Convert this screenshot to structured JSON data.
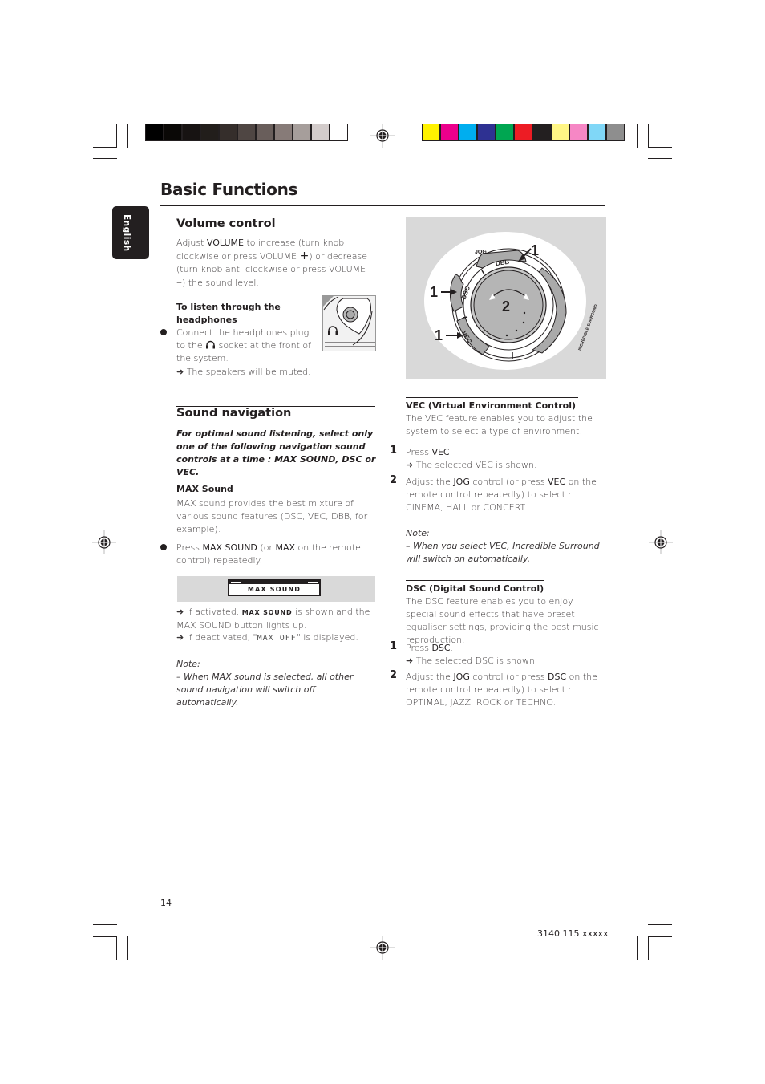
{
  "print_marks": {
    "grayscale_swatches": [
      "#000000",
      "#0a0806",
      "#171312",
      "#221e1b",
      "#352e2b",
      "#4f4643",
      "#695e5b",
      "#877b78",
      "#a69e9b",
      "#d3cccb",
      "#ffffff"
    ],
    "color_swatches": [
      "#fff200",
      "#ec008c",
      "#00aeef",
      "#2e3192",
      "#00a651",
      "#ed1c24",
      "#231f20",
      "#fff685",
      "#f687c5",
      "#80d7f7",
      "#8e8e8e"
    ]
  },
  "page": {
    "title": "Basic Functions",
    "language_tab": "English",
    "page_number": "14",
    "doc_code": "3140 115 xxxxx"
  },
  "volume_control": {
    "heading": "Volume control",
    "text_1": "Adjust ",
    "bold_volume": "VOLUME",
    "text_2": " to increase (turn knob clockwise or press VOLUME ",
    "plus": "+",
    "text_3": ") or decrease (turn knob anti-clockwise or press VOLUME ",
    "minus": "–",
    "text_4": ") the sound level.",
    "headphones": {
      "heading": "To listen through the headphones",
      "step_1a": "Connect the headphones plug to the ",
      "step_1b": " socket at the front of the system.",
      "result": "➜ The speakers will be muted.",
      "icon": "headphones-icon"
    }
  },
  "sound_navigation": {
    "heading": "Sound navigation",
    "intro": "For optimal sound listening, select only one of the following navigation sound controls at a time : MAX SOUND, DSC or VEC.",
    "max_sound": {
      "heading": "MAX Sound",
      "description": "MAX sound provides the best mixture of various sound features (DSC, VEC, DBB, for example).",
      "step_prefix": "Press ",
      "step_bold_1": "MAX SOUND",
      "step_mid": " (or ",
      "step_bold_2": "MAX",
      "step_suffix": " on the remote control) repeatedly.",
      "display_label": "MAX SOUND",
      "result_1a": "➜ If activated, ",
      "result_1_caps": "MAX SOUND",
      "result_1b": " is shown and the MAX SOUND button lights up.",
      "result_2a": "➜ If deactivated, \"",
      "result_2_lcd": "MAX OFF",
      "result_2b": "\" is displayed.",
      "note_label": "Note:",
      "note_text": "–  When MAX sound is selected, all other sound navigation will switch off automatically."
    }
  },
  "diagram": {
    "labels": {
      "jog": "JOG",
      "dbb": "DBB",
      "dsc": "DSC",
      "vec": "VEC",
      "surround": "INCREDIBLE SURROUND",
      "callout_1": "1",
      "callout_2": "2"
    }
  },
  "vec": {
    "heading": "VEC (Virtual Environment Control)",
    "description": "The VEC feature enables you to adjust the system to select a type of environment.",
    "steps": [
      {
        "num": "1",
        "prefix": "Press ",
        "bold": "VEC",
        "suffix": ".",
        "result": "➜ The selected VEC is shown."
      },
      {
        "num": "2",
        "prefix": "Adjust the ",
        "bold": "JOG",
        "mid": " control (or press ",
        "bold2": "VEC",
        "suffix": " on the remote control repeatedly) to select : CINEMA, HALL or CONCERT."
      }
    ],
    "note_label": "Note:",
    "note_text": "–  When you select VEC, Incredible Surround will switch on automatically."
  },
  "dsc": {
    "heading": "DSC (Digital Sound Control)",
    "description": "The DSC feature enables you to enjoy special sound effects that have preset equaliser settings, providing the best music reproduction.",
    "steps": [
      {
        "num": "1",
        "prefix": "Press ",
        "bold": "DSC",
        "suffix": ".",
        "result": "➜ The selected DSC is shown."
      },
      {
        "num": "2",
        "prefix": "Adjust the ",
        "bold": "JOG",
        "mid": " control (or press ",
        "bold2": "DSC",
        "suffix": " on the remote control repeatedly) to select : OPTIMAL, JAZZ, ROCK or TECHNO."
      }
    ]
  }
}
